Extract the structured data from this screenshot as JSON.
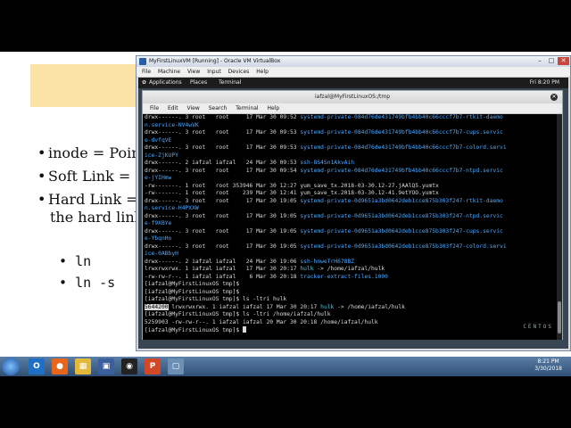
{
  "slide": {
    "bullets": [
      "inode = Point",
      "Soft Link = Li",
      "Hard Link = ",
      "the hard link"
    ],
    "commands": [
      "ln",
      "ln -s"
    ]
  },
  "vbox": {
    "title": "MyFirstLinuxVM [Running] - Oracle VM VirtualBox",
    "menu": [
      "File",
      "Machine",
      "View",
      "Input",
      "Devices",
      "Help"
    ],
    "controls": {
      "minimize": "–",
      "maximize": "□",
      "close": "✕"
    }
  },
  "gnome": {
    "applications": "Applications",
    "places": "Places",
    "terminal": "Terminal",
    "clock": "Fri  8:20 PM"
  },
  "terminal": {
    "title": "iafzal@MyFirstLinuxOS:/tmp",
    "close": "✕",
    "menu": [
      "File",
      "Edit",
      "View",
      "Search",
      "Terminal",
      "Help"
    ],
    "lines": [
      {
        "pre": "drwx------. 3 root   root     17 Mar 30 09:52 ",
        "hl": "",
        "name": "systemd-private-084d76de431749bfb4bb40c66cccf7b7-rtkit-daemo",
        "color": "blue"
      },
      {
        "pre": "",
        "hl": "",
        "name": "n.service-NV4wVK",
        "color": "blue"
      },
      {
        "pre": "drwx------. 3 root   root     17 Mar 30 09:53 ",
        "hl": "",
        "name": "systemd-private-084d76de431749bfb4bb40c66cccf7b7-cups.servic",
        "color": "blue"
      },
      {
        "pre": "",
        "hl": "",
        "name": "e-dvfqVE",
        "color": "blue"
      },
      {
        "pre": "drwx------. 3 root   root     17 Mar 30 09:53 ",
        "hl": "",
        "name": "systemd-private-084d76de431749bfb4bb40c66cccf7b7-colord.servi",
        "color": "blue"
      },
      {
        "pre": "",
        "hl": "",
        "name": "ice-ZjKUPY",
        "color": "blue"
      },
      {
        "pre": "drwx------. 2 iafzal iafzal   24 Mar 30 09:53 ",
        "hl": "",
        "name": "ssh-8S4Sn1AkvAih",
        "color": "blue"
      },
      {
        "pre": "drwx------. 3 root   root     17 Mar 30 09:54 ",
        "hl": "",
        "name": "systemd-private-084d76de431749bfb4bb40c66cccf7b7-ntpd.servic",
        "color": "blue"
      },
      {
        "pre": "",
        "hl": "",
        "name": "e-jYIHmw",
        "color": "blue"
      },
      {
        "pre": "-rw-------. 1 root   root 353946 Mar 30 12:27 yum_save_tx.2018-03-30.12-27.jAAlQ5.yumtx",
        "hl": "",
        "name": "",
        "color": ""
      },
      {
        "pre": "-rw-------. 1 root   root    239 Mar 30 12:41 yum_save_tx.2018-03-30.12-41.9etYOO.yumtx",
        "hl": "",
        "name": "",
        "color": ""
      },
      {
        "pre": "drwx------. 3 root   root     17 Mar 30 19:05 ",
        "hl": "",
        "name": "systemd-private-0d9651a3bd0642deb1cce875b303f247-rtkit-daemo",
        "color": "blue"
      },
      {
        "pre": "",
        "hl": "",
        "name": "n.service-H4PXXW",
        "color": "blue"
      },
      {
        "pre": "drwx------. 3 root   root     17 Mar 30 19:05 ",
        "hl": "",
        "name": "systemd-private-0d9651a3bd0642deb1cce875b303f247-ntpd.servic",
        "color": "blue"
      },
      {
        "pre": "",
        "hl": "",
        "name": "e-f9XBYe",
        "color": "blue"
      },
      {
        "pre": "drwx------. 3 root   root     17 Mar 30 19:05 ",
        "hl": "",
        "name": "systemd-private-0d9651a3bd0642deb1cce875b303f247-cups.servic",
        "color": "blue"
      },
      {
        "pre": "",
        "hl": "",
        "name": "e-YbqnHo",
        "color": "blue"
      },
      {
        "pre": "drwx------. 3 root   root     17 Mar 30 19:05 ",
        "hl": "",
        "name": "systemd-private-0d9651a3bd0642deb1cce875b303f247-colord.servi",
        "color": "blue"
      },
      {
        "pre": "",
        "hl": "",
        "name": "ice-0ABbyH",
        "color": "blue"
      },
      {
        "pre": "drwx------. 2 iafzal iafzal   24 Mar 30 19:06 ",
        "hl": "",
        "name": "ssh-hnweTrH678BZ",
        "color": "blue"
      },
      {
        "pre": "lrwxrwxrwx. 1 iafzal iafzal   17 Mar 30 20:17 ",
        "hl": "",
        "name": "hulk",
        "color": "cyan",
        "post": " -> /home/iafzal/hulk"
      },
      {
        "pre": "-rw-rw-r--. 1 iafzal iafzal    6 Mar 30 20:18 ",
        "hl": "",
        "name": "tracker-extract-files.1000",
        "color": "blue"
      },
      {
        "pre": "[iafzal@MyFirstLinuxOS tmp]$",
        "hl": "",
        "name": "",
        "color": ""
      },
      {
        "pre": "[iafzal@MyFirstLinuxOS tmp]$",
        "hl": "",
        "name": "",
        "color": ""
      },
      {
        "pre": "[iafzal@MyFirstLinuxOS tmp]$ ls -ltri hulk",
        "hl": "",
        "name": "",
        "color": ""
      },
      {
        "pre": "",
        "hl": "5644200",
        "mid": " lrwxrwxrwx. 1 iafzal iafzal 17 Mar 30 20:17 ",
        "name": "hulk",
        "color": "cyan",
        "post": " -> /home/iafzal/hulk"
      },
      {
        "pre": "[iafzal@MyFirstLinuxOS tmp]$ ls -ltri /home/iafzal/hulk",
        "hl": "",
        "name": "",
        "color": ""
      },
      {
        "pre": "5259903 -rw-rw-r--. 1 iafzal iafzal 20 Mar 30 20:18 /home/iafzal/hulk",
        "hl": "",
        "name": "",
        "color": ""
      },
      {
        "pre": "[iafzal@MyFirstLinuxOS tmp]$ ",
        "hl": "",
        "name": "",
        "color": "",
        "cursor": true
      }
    ],
    "watermark": "CENTOS"
  },
  "taskbar": {
    "icons": [
      {
        "name": "outlook-icon",
        "glyph": "O",
        "color": "#1f6fc5"
      },
      {
        "name": "firefox-icon",
        "glyph": "●",
        "color": "#e8661c"
      },
      {
        "name": "explorer-icon",
        "glyph": "▦",
        "color": "#e2b93b"
      },
      {
        "name": "virtualbox-icon",
        "glyph": "▣",
        "color": "#3c5f9e"
      },
      {
        "name": "obs-icon",
        "glyph": "◉",
        "color": "#222222"
      },
      {
        "name": "powerpoint-icon",
        "glyph": "P",
        "color": "#d24726"
      },
      {
        "name": "app-icon",
        "glyph": "▢",
        "color": "#6c8fb4"
      }
    ],
    "time": "8:21 PM",
    "date": "3/30/2018"
  },
  "colors": {
    "term_bg": "#000000",
    "dir_blue": "#4aa8ff",
    "link_cyan": "#3ad0e0"
  }
}
